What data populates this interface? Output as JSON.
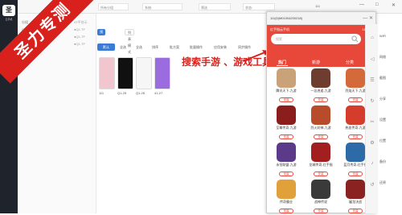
{
  "app": {
    "logo_glyph": "圣",
    "logo_caption": "云手机"
  },
  "banner": {
    "text": "圣力专测"
  },
  "topbar": {
    "field1": "所有分组",
    "field2": "系统:",
    "field3": "筛选",
    "field4": "状态:",
    "user": "111",
    "minimize": "—",
    "maximize": "□",
    "close": "✕"
  },
  "groups": {
    "items": [
      "分组",
      "Q1-156",
      "Q1-26",
      "Q3-23"
    ],
    "right_items": [
      "4T平台示",
      "●Q1-TF",
      "●Q1-TF",
      "●Q1-TF"
    ]
  },
  "main": {
    "mode_preview": "预览模式",
    "mode_list": "列表模式",
    "tool_all": "全选",
    "tool_select": "全选",
    "tool_sort": "排序",
    "tool_group": "批方案",
    "tool_batch": "批量操作",
    "tool_install": "应用安装",
    "tool_sync": "同步操作",
    "btn_default": "默认",
    "cards": [
      {
        "label": "111",
        "color": "#f1c6cf"
      },
      {
        "label": "Q1-25",
        "color": "#101010"
      },
      {
        "label": "Q1-26",
        "color": "#f6f6f6"
      },
      {
        "label": "41-27",
        "color": "#9b6be0"
      }
    ]
  },
  "annotation": {
    "text": "搜索手游 、游戏工具"
  },
  "phone": {
    "title": "111(5)M01004200218)",
    "controls": "— ✕",
    "app_name": "红手指云手机",
    "status": "11:28",
    "search_placeholder": "搜索",
    "tabs": [
      "热门",
      "新游",
      "分类"
    ],
    "games": [
      {
        "name": "腾讯天下-九游",
        "btn": "安装",
        "color": "#c9a27a"
      },
      {
        "name": "一念逍遥-九游",
        "btn": "安装",
        "color": "#6e3d2f"
      },
      {
        "name": "烈焰天下-九游",
        "btn": "安装",
        "color": "#d46a3a"
      },
      {
        "name": "至尊传奇-九游",
        "btn": "安装",
        "color": "#8c1d1d"
      },
      {
        "name": "烈火封神-九游",
        "btn": "安装",
        "color": "#b84b2a"
      },
      {
        "name": "热血传奇-九游",
        "btn": "安装",
        "color": "#d43c2c"
      },
      {
        "name": "永恒联盟-九游",
        "btn": "安装",
        "color": "#5b3a8a"
      },
      {
        "name": "龙城传奇-红手指",
        "btn": "安装",
        "color": "#a31f1f"
      },
      {
        "name": "蓝月传奇-红手指",
        "btn": "安装",
        "color": "#2c6aa8"
      },
      {
        "name": "传奇霸业",
        "btn": "安装",
        "color": "#e0a03a"
      },
      {
        "name": "战神传说",
        "btn": "安装",
        "color": "#3a3a3a"
      },
      {
        "name": "屠龙决战",
        "btn": "安装",
        "color": "#8a2222"
      }
    ]
  },
  "side_tools": [
    "⌂",
    "◁",
    "☰",
    "↻",
    "✂",
    "⚙",
    "♪",
    "↺"
  ],
  "right_panel": {
    "items": [
      "WiFi",
      "网络",
      "截图",
      "分享",
      "设置",
      "位置",
      "备份",
      "还原"
    ],
    "top_items": [
      "●",
      "切换横竖",
      "收起功能"
    ]
  },
  "colors": {
    "accent": "#e8483a",
    "banner": "#d8211c",
    "sidebar": "#1f232b"
  }
}
